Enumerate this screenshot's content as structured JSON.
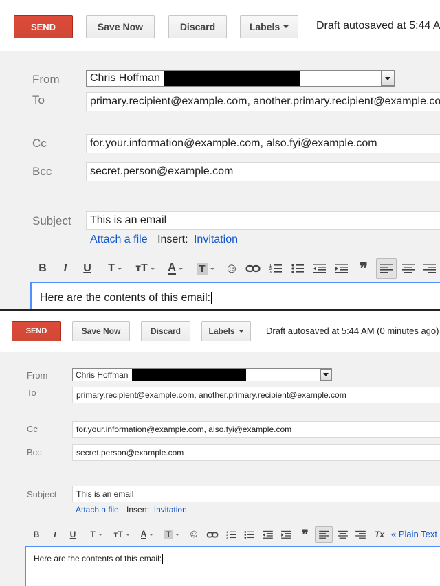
{
  "toolbar": {
    "send_label": "SEND",
    "save_label": "Save Now",
    "discard_label": "Discard",
    "labels_label": "Labels"
  },
  "status": {
    "top": "Draft autosaved at 5:44 AM",
    "bottom": "Draft autosaved at 5:44 AM (0 minutes ago)"
  },
  "fields": {
    "from_label": "From",
    "from_value": "Chris Hoffman",
    "to_label": "To",
    "to_value": "primary.recipient@example.com, another.primary.recipient@example.com",
    "cc_label": "Cc",
    "cc_value": "for.your.information@example.com, also.fyi@example.com",
    "bcc_label": "Bcc",
    "bcc_value": "secret.person@example.com",
    "subject_label": "Subject",
    "subject_value": "This is an email"
  },
  "attach": {
    "attach_label": "Attach a file",
    "insert_label": "Insert:",
    "invitation_label": "Invitation"
  },
  "format": {
    "bold_glyph": "B",
    "italic_glyph": "I",
    "underline_glyph": "U",
    "font_glyph": "T",
    "size_glyph": "тT",
    "textcolor_glyph": "A",
    "highlight_glyph": "T",
    "emoji_glyph": "☺",
    "quote_glyph": "❞",
    "clear_glyph": "Tx",
    "plain_text_label": "« Plain Text"
  },
  "compose": {
    "body_text": "Here are the contents of this email:"
  },
  "icons": {
    "link": "link-icon",
    "numbered_list": "numbered-list-icon",
    "bulleted_list": "bulleted-list-icon",
    "indent_less": "indent-less-icon",
    "indent_more": "indent-more-icon",
    "align_left": "align-left-icon",
    "align_center": "align-center-icon",
    "align_right": "align-right-icon"
  },
  "colors": {
    "send": "#d14836",
    "link": "#1155cc",
    "focus_border": "#4d90fe",
    "background_gray": "#f1f1f1"
  }
}
